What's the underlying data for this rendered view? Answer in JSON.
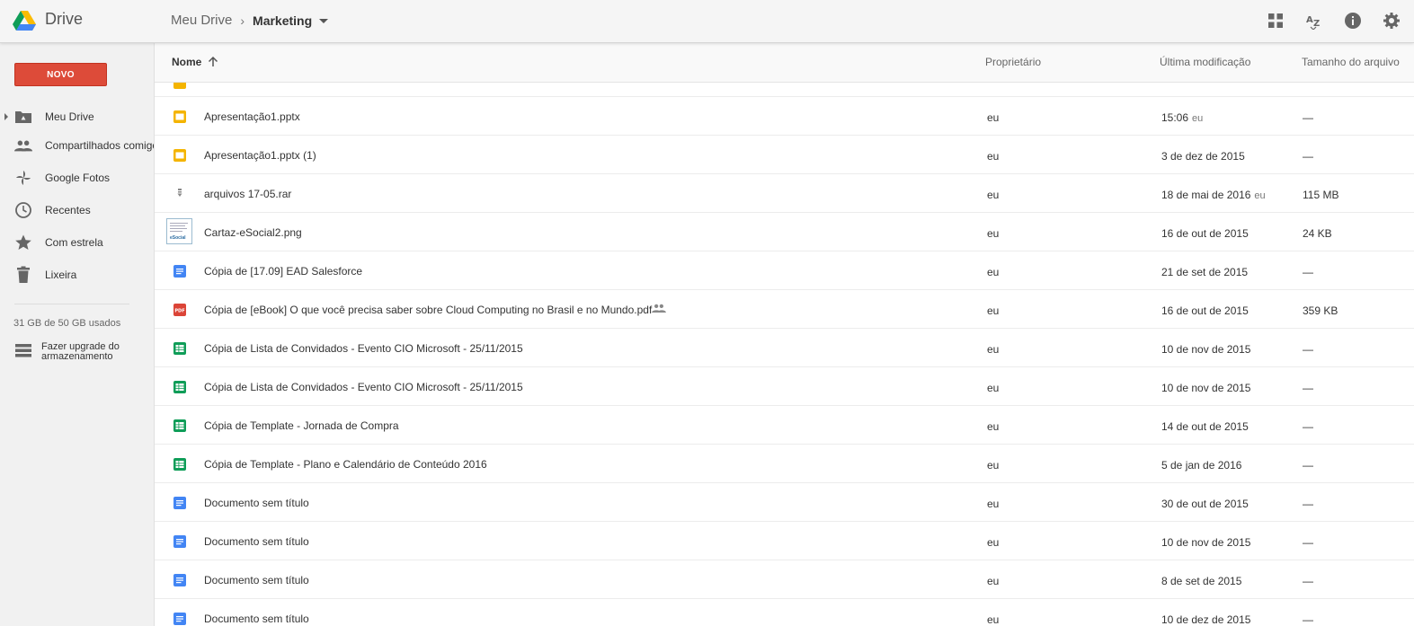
{
  "header": {
    "app_name": "Drive",
    "breadcrumb_root": "Meu Drive",
    "breadcrumb_sep": "›",
    "breadcrumb_current": "Marketing",
    "icons": [
      "grid-view-icon",
      "sort-az-icon",
      "info-icon",
      "settings-icon"
    ]
  },
  "sidebar": {
    "new_label": "NOVO",
    "items": [
      {
        "label": "Meu Drive",
        "icon": "drive-folder-icon"
      },
      {
        "label": "Compartilhados comigo",
        "icon": "people-icon"
      },
      {
        "label": "Google Fotos",
        "icon": "photos-icon"
      },
      {
        "label": "Recentes",
        "icon": "clock-icon"
      },
      {
        "label": "Com estrela",
        "icon": "star-icon"
      },
      {
        "label": "Lixeira",
        "icon": "trash-icon"
      }
    ],
    "storage_used": "31 GB de 50 GB usados",
    "upgrade_label": "Fazer upgrade do armazenamento"
  },
  "columns": {
    "name": "Nome",
    "owner": "Proprietário",
    "modified": "Última modificação",
    "size": "Tamanho do arquivo"
  },
  "files": [
    {
      "name": "Apresentação1.pptx",
      "type": "slides",
      "owner": "eu",
      "modified": "15:06",
      "modified_by": "eu",
      "size": "—"
    },
    {
      "name": "Apresentação1.pptx (1)",
      "type": "slides",
      "owner": "eu",
      "modified": "3 de dez de 2015",
      "modified_by": "",
      "size": "—"
    },
    {
      "name": "arquivos 17-05.rar",
      "type": "archive",
      "owner": "eu",
      "modified": "18 de mai de 2016",
      "modified_by": "eu",
      "size": "115 MB"
    },
    {
      "name": "Cartaz-eSocial2.png",
      "type": "image",
      "owner": "eu",
      "modified": "16 de out de 2015",
      "modified_by": "",
      "size": "24 KB"
    },
    {
      "name": "Cópia de [17.09] EAD Salesforce",
      "type": "doc",
      "owner": "eu",
      "modified": "21 de set de 2015",
      "modified_by": "",
      "size": "—"
    },
    {
      "name": "Cópia de [eBook] O que você precisa saber sobre Cloud Computing no Brasil e no Mundo.pdf",
      "type": "pdf",
      "shared": true,
      "owner": "eu",
      "modified": "16 de out de 2015",
      "modified_by": "",
      "size": "359 KB"
    },
    {
      "name": "Cópia de Lista de Convidados - Evento CIO Microsoft - 25/11/2015",
      "type": "sheet",
      "owner": "eu",
      "modified": "10 de nov de 2015",
      "modified_by": "",
      "size": "—"
    },
    {
      "name": "Cópia de Lista de Convidados - Evento CIO Microsoft - 25/11/2015",
      "type": "sheet",
      "owner": "eu",
      "modified": "10 de nov de 2015",
      "modified_by": "",
      "size": "—"
    },
    {
      "name": "Cópia de Template - Jornada de Compra",
      "type": "sheet",
      "owner": "eu",
      "modified": "14 de out de 2015",
      "modified_by": "",
      "size": "—"
    },
    {
      "name": "Cópia de Template - Plano e Calendário de Conteúdo 2016",
      "type": "sheet",
      "owner": "eu",
      "modified": "5 de jan de 2016",
      "modified_by": "",
      "size": "—"
    },
    {
      "name": "Documento sem título",
      "type": "doc",
      "owner": "eu",
      "modified": "30 de out de 2015",
      "modified_by": "",
      "size": "—"
    },
    {
      "name": "Documento sem título",
      "type": "doc",
      "owner": "eu",
      "modified": "10 de nov de 2015",
      "modified_by": "",
      "size": "—"
    },
    {
      "name": "Documento sem título",
      "type": "doc",
      "owner": "eu",
      "modified": "8 de set de 2015",
      "modified_by": "",
      "size": "—"
    },
    {
      "name": "Documento sem título",
      "type": "doc",
      "owner": "eu",
      "modified": "10 de dez de 2015",
      "modified_by": "",
      "size": "—"
    }
  ],
  "thumbnail_text": "eSocial",
  "colors": {
    "new_button": "#dd4b39",
    "slides": "#f4b400",
    "doc": "#4285f4",
    "sheet": "#0f9d58",
    "pdf": "#db4437"
  }
}
